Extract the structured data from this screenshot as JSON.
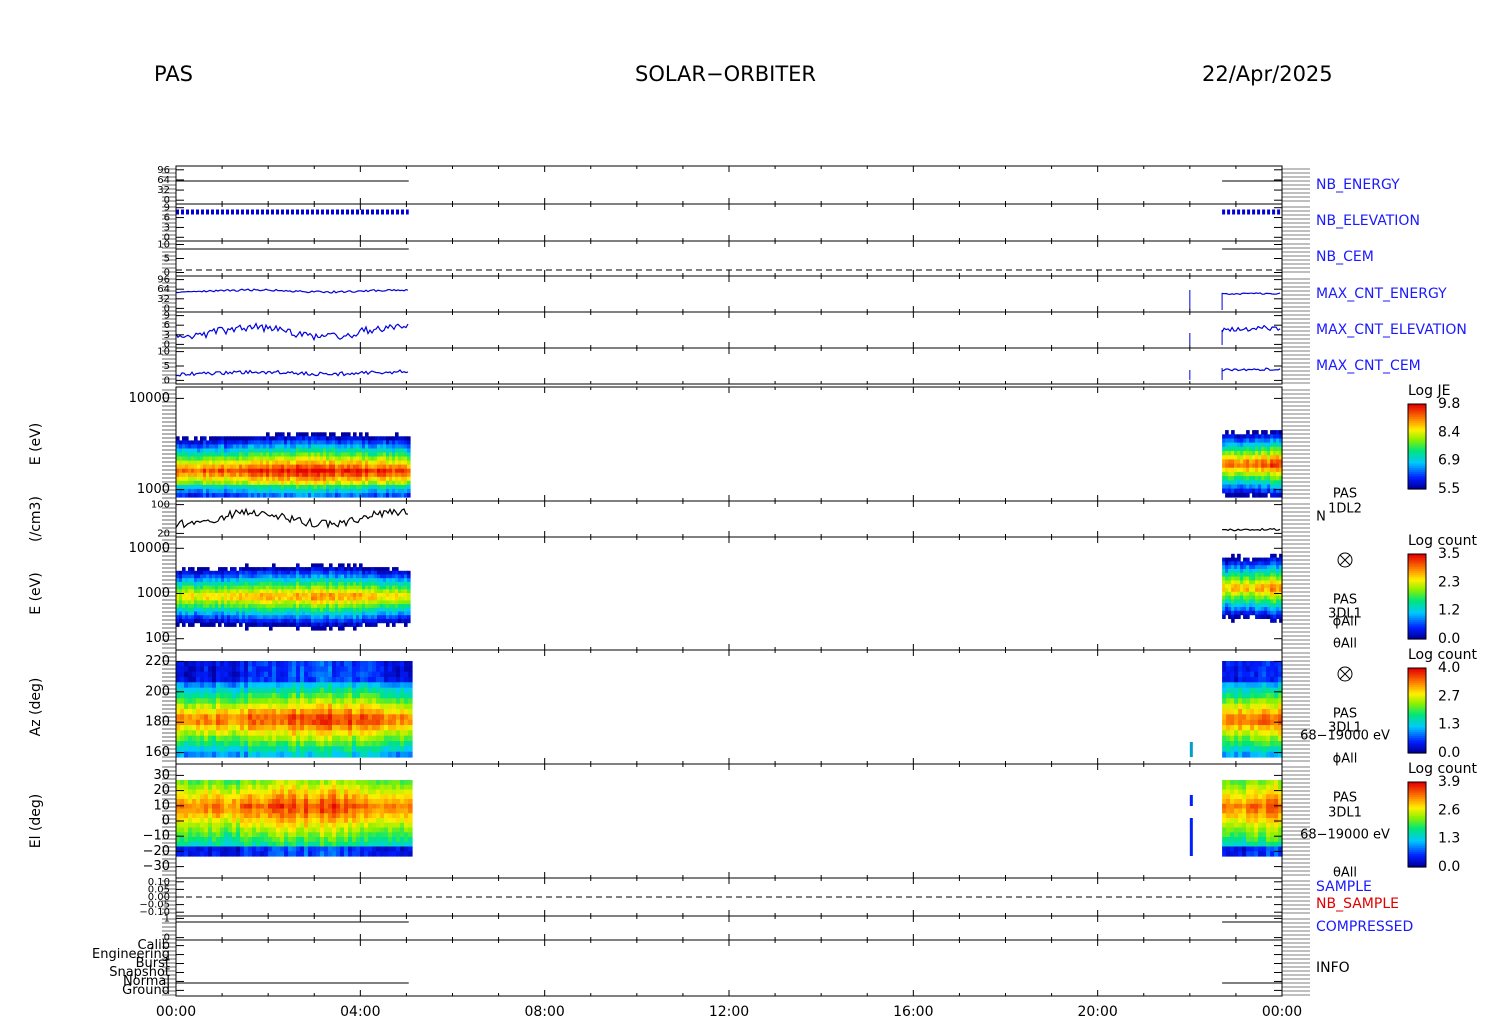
{
  "header": {
    "instrument": "PAS",
    "mission": "SOLAR−ORBITER",
    "date": "22/Apr/2025"
  },
  "colors": {
    "label_blue": "#1a1aff",
    "label_red": "#e00000",
    "data_blue": "#0000dd",
    "axis": "#000000"
  },
  "chart_data": {
    "type": "heatmap",
    "x_axis": {
      "ticks": [
        "00:00",
        "04:00",
        "08:00",
        "12:00",
        "16:00",
        "20:00",
        "00:00"
      ],
      "range_hours": [
        0,
        24
      ]
    },
    "data_coverage_hours": [
      [
        0,
        5.05
      ],
      [
        22.0,
        22.05
      ],
      [
        22.7,
        24
      ]
    ],
    "panels": [
      {
        "id": "nb_energy",
        "label": "NB_ENERGY",
        "label_color": "blue",
        "ylabel": "",
        "yticks": [
          "96",
          "64",
          "32",
          "0"
        ]
      },
      {
        "id": "nb_elevation",
        "label": "NB_ELEVATION",
        "label_color": "blue",
        "ylabel": "",
        "yticks": [
          "9",
          "6",
          "3",
          "0"
        ]
      },
      {
        "id": "nb_cem",
        "label": "NB_CEM",
        "label_color": "blue",
        "ylabel": "",
        "yticks": [
          "10",
          "5",
          "0"
        ]
      },
      {
        "id": "max_cnt_energy",
        "label": "MAX_CNT_ENERGY",
        "label_color": "blue",
        "ylabel": "",
        "yticks": [
          "96",
          "64",
          "32",
          "0"
        ]
      },
      {
        "id": "max_cnt_elevation",
        "label": "MAX_CNT_ELEVATION",
        "label_color": "blue",
        "ylabel": "",
        "yticks": [
          "9",
          "6",
          "3",
          "0"
        ]
      },
      {
        "id": "max_cnt_cem",
        "label": "MAX_CNT_CEM",
        "label_color": "blue",
        "ylabel": "",
        "yticks": [
          "10",
          "5",
          "0"
        ]
      },
      {
        "id": "je_spectrogram",
        "label": "",
        "ylabel": "E (eV)",
        "yticks": [
          "10000",
          "1000"
        ],
        "scale": "log",
        "colorbar": {
          "title": "Log JE",
          "ticks": [
            "9.8",
            "8.4",
            "6.9",
            "5.5"
          ],
          "min": 5.5,
          "max": 9.8
        }
      },
      {
        "id": "density",
        "label": "",
        "ylabel": "(/cm3)",
        "yticks": [
          "100",
          "20"
        ],
        "scale": "log",
        "side_text": [
          "PAS",
          "1DL2",
          "N"
        ]
      },
      {
        "id": "energy_count",
        "label": "",
        "ylabel": "E (eV)",
        "yticks": [
          "10000",
          "1000",
          "100"
        ],
        "scale": "log",
        "side_text": [
          "PAS",
          "3DL1",
          "ϕAll",
          "θAll"
        ],
        "colorbar": {
          "title": "Log count",
          "ticks": [
            "3.5",
            "2.3",
            "1.2",
            "0.0"
          ],
          "min": 0.0,
          "max": 3.5
        }
      },
      {
        "id": "azimuth",
        "label": "",
        "ylabel": "Az (deg)",
        "yticks": [
          "220",
          "200",
          "180",
          "160"
        ],
        "ylim": [
          150,
          225
        ],
        "side_text": [
          "PAS",
          "3DL1",
          "68−19000 eV",
          "ϕAll"
        ],
        "colorbar": {
          "title": "Log count",
          "ticks": [
            "4.0",
            "2.7",
            "1.3",
            "0.0"
          ],
          "min": 0.0,
          "max": 4.0
        }
      },
      {
        "id": "elevation",
        "label": "",
        "ylabel": "El (deg)",
        "yticks": [
          "30",
          "20",
          "10",
          "0",
          "−10",
          "−20",
          "−30"
        ],
        "ylim": [
          -30,
          30
        ],
        "side_text": [
          "PAS",
          "3DL1",
          "68−19000 eV",
          "θAll"
        ],
        "colorbar": {
          "title": "Log count",
          "ticks": [
            "3.9",
            "2.6",
            "1.3",
            "0.0"
          ],
          "min": 0.0,
          "max": 3.9
        }
      },
      {
        "id": "sample",
        "label": "SAMPLE",
        "label2": "NB_SAMPLE",
        "label_color": "blue",
        "label2_color": "red",
        "ylabel": "",
        "yticks": [
          "0.10",
          "0.05",
          "0.00",
          "−0.05",
          "−0.10"
        ]
      },
      {
        "id": "compressed",
        "label": "COMPRESSED",
        "label_color": "blue",
        "ylabel": "",
        "yticks": [
          "1",
          "0"
        ]
      },
      {
        "id": "info",
        "label": "INFO",
        "label_color": "black",
        "ylabel": "",
        "yticks": [
          "Calib",
          "Engineering",
          "Burst",
          "Snapshot",
          "Normal",
          "Ground"
        ]
      }
    ]
  }
}
